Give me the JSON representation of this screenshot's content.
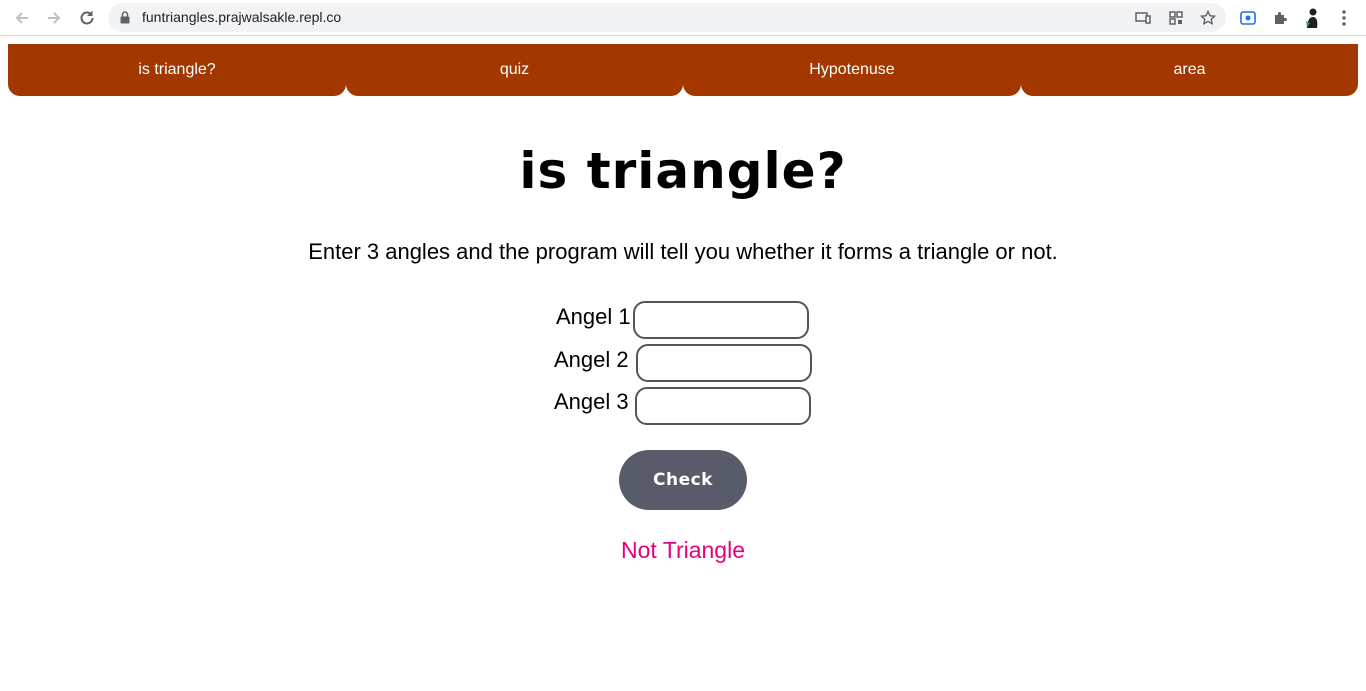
{
  "browser": {
    "url": "funtriangles.prajwalsakle.repl.co",
    "icons": [
      "back-icon",
      "forward-icon",
      "reload-icon",
      "lock-icon",
      "cast-icon",
      "qr-code-icon",
      "bookmark-star-icon",
      "screen-capture-icon",
      "extensions-icon",
      "profile-avatar",
      "more-menu-icon"
    ]
  },
  "nav": {
    "tabs": [
      {
        "label": "is triangle?"
      },
      {
        "label": "quiz"
      },
      {
        "label": "Hypotenuse"
      },
      {
        "label": "area"
      }
    ],
    "color": "#a23700"
  },
  "main": {
    "title": "is triangle?",
    "instructions": "Enter 3 angles and the program will tell you whether it forms a triangle or not.",
    "angles": [
      {
        "label": "Angel 1",
        "value": ""
      },
      {
        "label": "Angel 2",
        "value": ""
      },
      {
        "label": "Angel 3",
        "value": ""
      }
    ],
    "check_label": "Check",
    "result": "Not Triangle",
    "result_color": "#e6007e",
    "button_color": "#585c6a"
  }
}
